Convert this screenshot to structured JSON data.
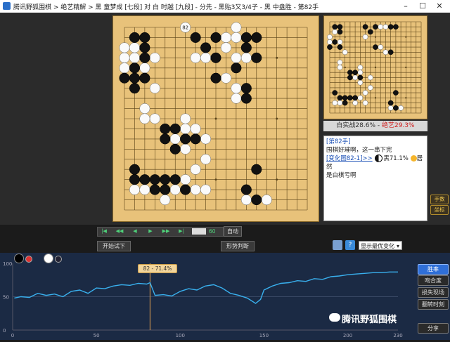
{
  "window": {
    "title": "腾讯野狐围棋 > 绝艺精解 > 黑 童梦成 [七段] 对 白 时越 [九段] - 分先 - 黑贴3又3/4子 - 黑 中盘胜 - 第82手",
    "min": "–",
    "max": "☐",
    "close": "✕"
  },
  "board": {
    "size": 19,
    "move_label": "82",
    "last_move": [
      6,
      0
    ],
    "black": [
      [
        1,
        1
      ],
      [
        2,
        1
      ],
      [
        7,
        1
      ],
      [
        9,
        1
      ],
      [
        12,
        1
      ],
      [
        13,
        1
      ],
      [
        2,
        2
      ],
      [
        8,
        2
      ],
      [
        12,
        2
      ],
      [
        2,
        3
      ],
      [
        9,
        3
      ],
      [
        13,
        3
      ],
      [
        1,
        4
      ],
      [
        11,
        4
      ],
      [
        0,
        5
      ],
      [
        1,
        5
      ],
      [
        2,
        5
      ],
      [
        9,
        5
      ],
      [
        1,
        6
      ],
      [
        12,
        6
      ],
      [
        12,
        7
      ],
      [
        4,
        10
      ],
      [
        5,
        10
      ],
      [
        4,
        11
      ],
      [
        6,
        11
      ],
      [
        7,
        11
      ],
      [
        5,
        12
      ],
      [
        1,
        14
      ],
      [
        13,
        14
      ],
      [
        1,
        15
      ],
      [
        2,
        15
      ],
      [
        3,
        15
      ],
      [
        4,
        15
      ],
      [
        5,
        15
      ],
      [
        3,
        16
      ],
      [
        4,
        16
      ],
      [
        6,
        16
      ],
      [
        12,
        16
      ],
      [
        13,
        17
      ]
    ],
    "white": [
      [
        1,
        1
      ],
      [
        0,
        2
      ],
      [
        1,
        2
      ],
      [
        10,
        1
      ],
      [
        11,
        1
      ],
      [
        1,
        3
      ],
      [
        3,
        3
      ],
      [
        0,
        3
      ],
      [
        0,
        4
      ],
      [
        2,
        4
      ],
      [
        7,
        3
      ],
      [
        8,
        3
      ],
      [
        10,
        2
      ],
      [
        11,
        3
      ],
      [
        12,
        3
      ],
      [
        10,
        5
      ],
      [
        3,
        6
      ],
      [
        11,
        6
      ],
      [
        11,
        7
      ],
      [
        11,
        0
      ],
      [
        2,
        8
      ],
      [
        2,
        9
      ],
      [
        3,
        9
      ],
      [
        6,
        9
      ],
      [
        6,
        10
      ],
      [
        7,
        10
      ],
      [
        5,
        11
      ],
      [
        8,
        11
      ],
      [
        6,
        12
      ],
      [
        8,
        13
      ],
      [
        7,
        14
      ],
      [
        6,
        15
      ],
      [
        2,
        16
      ],
      [
        5,
        16
      ],
      [
        7,
        16
      ],
      [
        8,
        16
      ],
      [
        1,
        16
      ],
      [
        4,
        17
      ],
      [
        12,
        17
      ],
      [
        14,
        17
      ]
    ]
  },
  "mini_board": {
    "black": [
      [
        1,
        1
      ],
      [
        2,
        1
      ],
      [
        7,
        1
      ],
      [
        8,
        2
      ],
      [
        9,
        1
      ],
      [
        12,
        1
      ],
      [
        13,
        1
      ],
      [
        2,
        2
      ],
      [
        1,
        4
      ],
      [
        0,
        5
      ],
      [
        2,
        5
      ],
      [
        9,
        5
      ],
      [
        12,
        6
      ],
      [
        4,
        10
      ],
      [
        5,
        10
      ],
      [
        4,
        11
      ],
      [
        6,
        11
      ],
      [
        1,
        14
      ],
      [
        13,
        14
      ],
      [
        2,
        15
      ],
      [
        3,
        15
      ],
      [
        4,
        15
      ],
      [
        5,
        15
      ],
      [
        3,
        16
      ],
      [
        12,
        16
      ],
      [
        13,
        17
      ]
    ],
    "white": [
      [
        1,
        2
      ],
      [
        0,
        3
      ],
      [
        0,
        4
      ],
      [
        2,
        4
      ],
      [
        7,
        3
      ],
      [
        10,
        1
      ],
      [
        11,
        1
      ],
      [
        10,
        5
      ],
      [
        3,
        6
      ],
      [
        11,
        6
      ],
      [
        2,
        8
      ],
      [
        2,
        9
      ],
      [
        6,
        9
      ],
      [
        6,
        10
      ],
      [
        5,
        11
      ],
      [
        8,
        11
      ],
      [
        6,
        12
      ],
      [
        8,
        13
      ],
      [
        7,
        14
      ],
      [
        6,
        15
      ],
      [
        2,
        16
      ],
      [
        5,
        16
      ],
      [
        7,
        16
      ],
      [
        1,
        16
      ],
      [
        12,
        17
      ],
      [
        14,
        17
      ]
    ]
  },
  "winrate": {
    "white": "白实战28.6%",
    "sep": " - ",
    "ai": "绝艺29.3%"
  },
  "comment": {
    "line1": "[第82手]",
    "line2": "围棋好璀啊，这一串下完",
    "variation_link": "[变化图82-1]>>",
    "black_rate": "黑71.1%",
    "suffix": "居然",
    "line4": "是白棋亏啊"
  },
  "side_buttons": {
    "hands": "手数",
    "marks": "坐标"
  },
  "nav": {
    "first": "|◀",
    "prev5": "◀◀",
    "prev": "◀",
    "next": "▶",
    "next5": "▶▶",
    "last": "▶|",
    "move": "60"
  },
  "auto_label": "自动",
  "buttons": {
    "trial": "开始试下",
    "judge": "形势判断"
  },
  "select": {
    "value": "显示最优变化"
  },
  "chart_data": {
    "type": "line",
    "x": [
      1,
      5,
      10,
      15,
      20,
      25,
      30,
      35,
      40,
      45,
      50,
      55,
      60,
      65,
      70,
      75,
      80,
      82,
      85,
      90,
      95,
      100,
      105,
      110,
      115,
      120,
      125,
      130,
      135,
      140,
      145,
      148,
      150,
      155,
      160,
      165,
      170,
      175,
      180,
      185,
      190,
      195,
      200,
      205,
      210,
      215,
      220,
      225,
      230
    ],
    "values": [
      48,
      50,
      49,
      55,
      52,
      54,
      50,
      58,
      60,
      55,
      63,
      62,
      66,
      68,
      67,
      70,
      69,
      71,
      52,
      53,
      51,
      58,
      62,
      60,
      66,
      68,
      63,
      55,
      52,
      48,
      40,
      46,
      60,
      66,
      70,
      71,
      74,
      73,
      77,
      76,
      80,
      81,
      83,
      84,
      85,
      86,
      86,
      87,
      87
    ],
    "ylim": [
      0,
      100
    ],
    "xlim": [
      0,
      230
    ],
    "y_ticks": [
      "100",
      "50",
      "0"
    ],
    "x_ticks": [
      "0",
      "50",
      "100",
      "150",
      "200",
      "230"
    ],
    "marker_label": "82 - 71.4%",
    "marker_x": 82
  },
  "chart_tabs": {
    "winrate": "胜率",
    "match": "吻合度",
    "blunder": "损失现场",
    "turning": "翻转时刻",
    "share": "分享"
  },
  "watermark": "腾讯野狐围棋"
}
